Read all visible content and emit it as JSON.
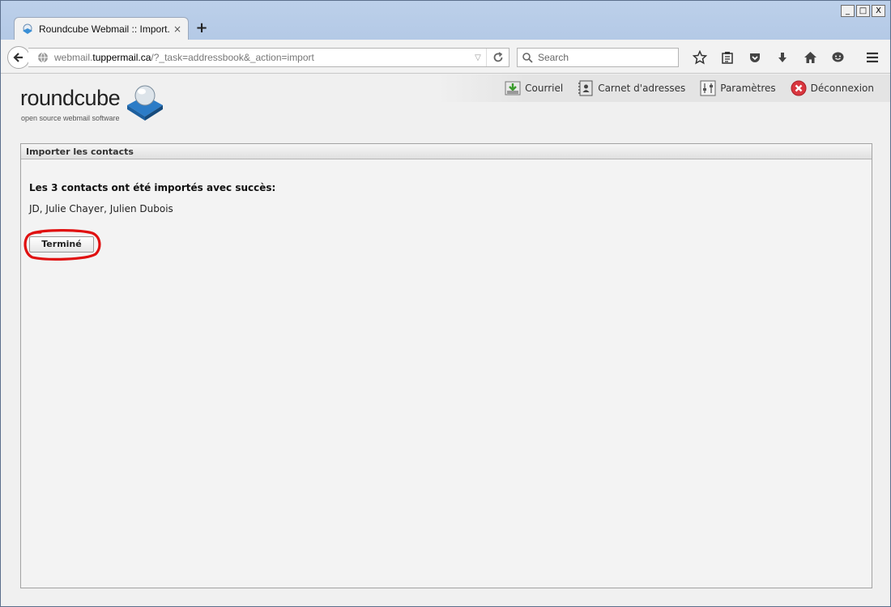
{
  "browser": {
    "tab_title": "Roundcube Webmail :: Import...",
    "tab_close": "×",
    "new_tab": "+",
    "window_buttons": {
      "minimize": "_",
      "maximize": "□",
      "close": "X"
    },
    "url": {
      "prefix": "webmail.",
      "host": "tuppermail.ca",
      "path": "/?_task=addressbook&_action=import"
    },
    "search_placeholder": "Search"
  },
  "logo": {
    "word": "roundcube",
    "tagline": "open source webmail software"
  },
  "top_nav": [
    {
      "label": "Courriel",
      "icon": "mail-icon"
    },
    {
      "label": "Carnet d'adresses",
      "icon": "addressbook-icon"
    },
    {
      "label": "Paramètres",
      "icon": "settings-icon"
    },
    {
      "label": "Déconnexion",
      "icon": "logout-icon"
    }
  ],
  "panel": {
    "title": "Importer les contacts",
    "success_message": "Les 3 contacts ont été importés avec succès:",
    "contacts": "JD, Julie Chayer, Julien Dubois",
    "done_button": "Terminé"
  },
  "colors": {
    "highlight": "#e01010",
    "logout": "#d9363e",
    "accent": "#3a8fd6"
  }
}
